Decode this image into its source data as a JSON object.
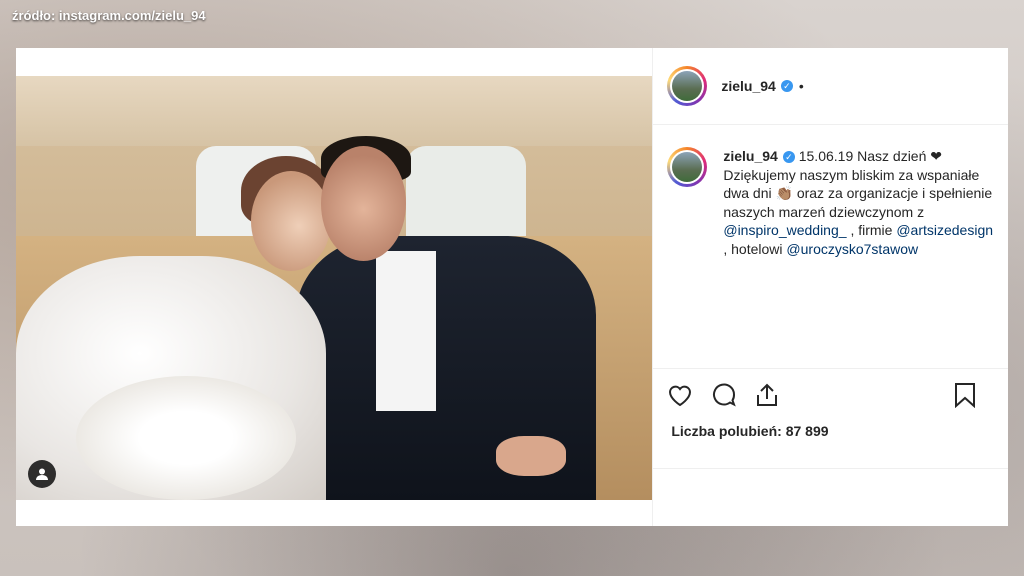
{
  "source_label": "źródło: instagram.com/zielu_94",
  "post": {
    "username": "zielu_94",
    "header_dot": "•",
    "caption": {
      "username": "zielu_94",
      "part1": "15.06.19 Nasz dzień ❤",
      "part2": "Dziękujemy naszym bliskim za wspaniałe dwa dni 👏🏽 oraz za organizacje i spełnienie naszych marzeń dziewczynom z",
      "mention1": "@inspiro_wedding_",
      "part3": ", firmie",
      "mention2": "@artsizedesign",
      "part4": ", hotelowi",
      "mention3": "@uroczysko7stawow"
    },
    "likes_label": "Liczba polubień: 87 899"
  },
  "icons": [
    "tag-user-icon",
    "heart-icon",
    "comment-icon",
    "share-icon",
    "bookmark-icon",
    "verified-icon"
  ]
}
